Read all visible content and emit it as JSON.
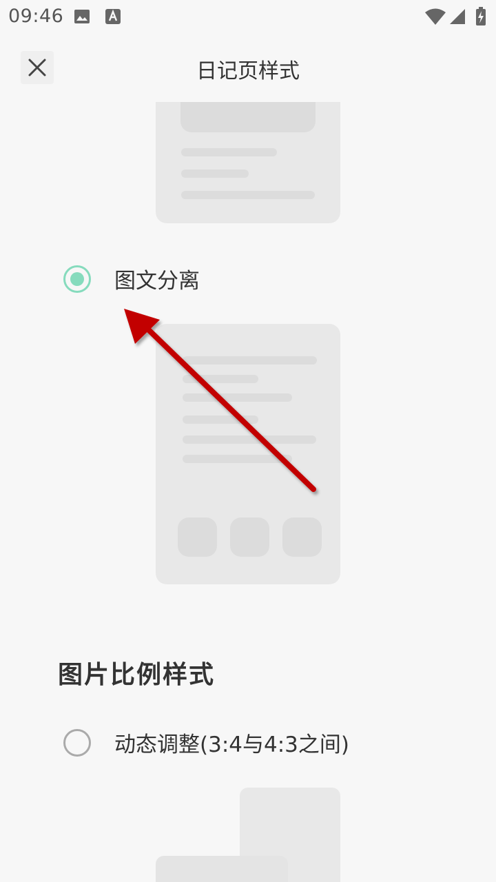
{
  "status_bar": {
    "time": "09:46",
    "left_icons": [
      "image-icon",
      "a-notification-icon"
    ],
    "right_icons": [
      "wifi-icon",
      "signal-icon",
      "battery-charging-icon"
    ]
  },
  "header": {
    "close_icon": "close-icon",
    "title": "日记页样式"
  },
  "diary_style": {
    "options": [
      {
        "label": "图文分离",
        "selected": true
      }
    ]
  },
  "image_ratio": {
    "title": "图片比例样式",
    "options": [
      {
        "label": "动态调整(3:4与4:3之间)",
        "selected": false
      }
    ]
  },
  "colors": {
    "accent": "#86dbbd",
    "annotation_arrow": "#c20000",
    "background": "#f7f7f7",
    "placeholder_card": "#e8e8e8",
    "placeholder_line": "#dcdcdc"
  }
}
